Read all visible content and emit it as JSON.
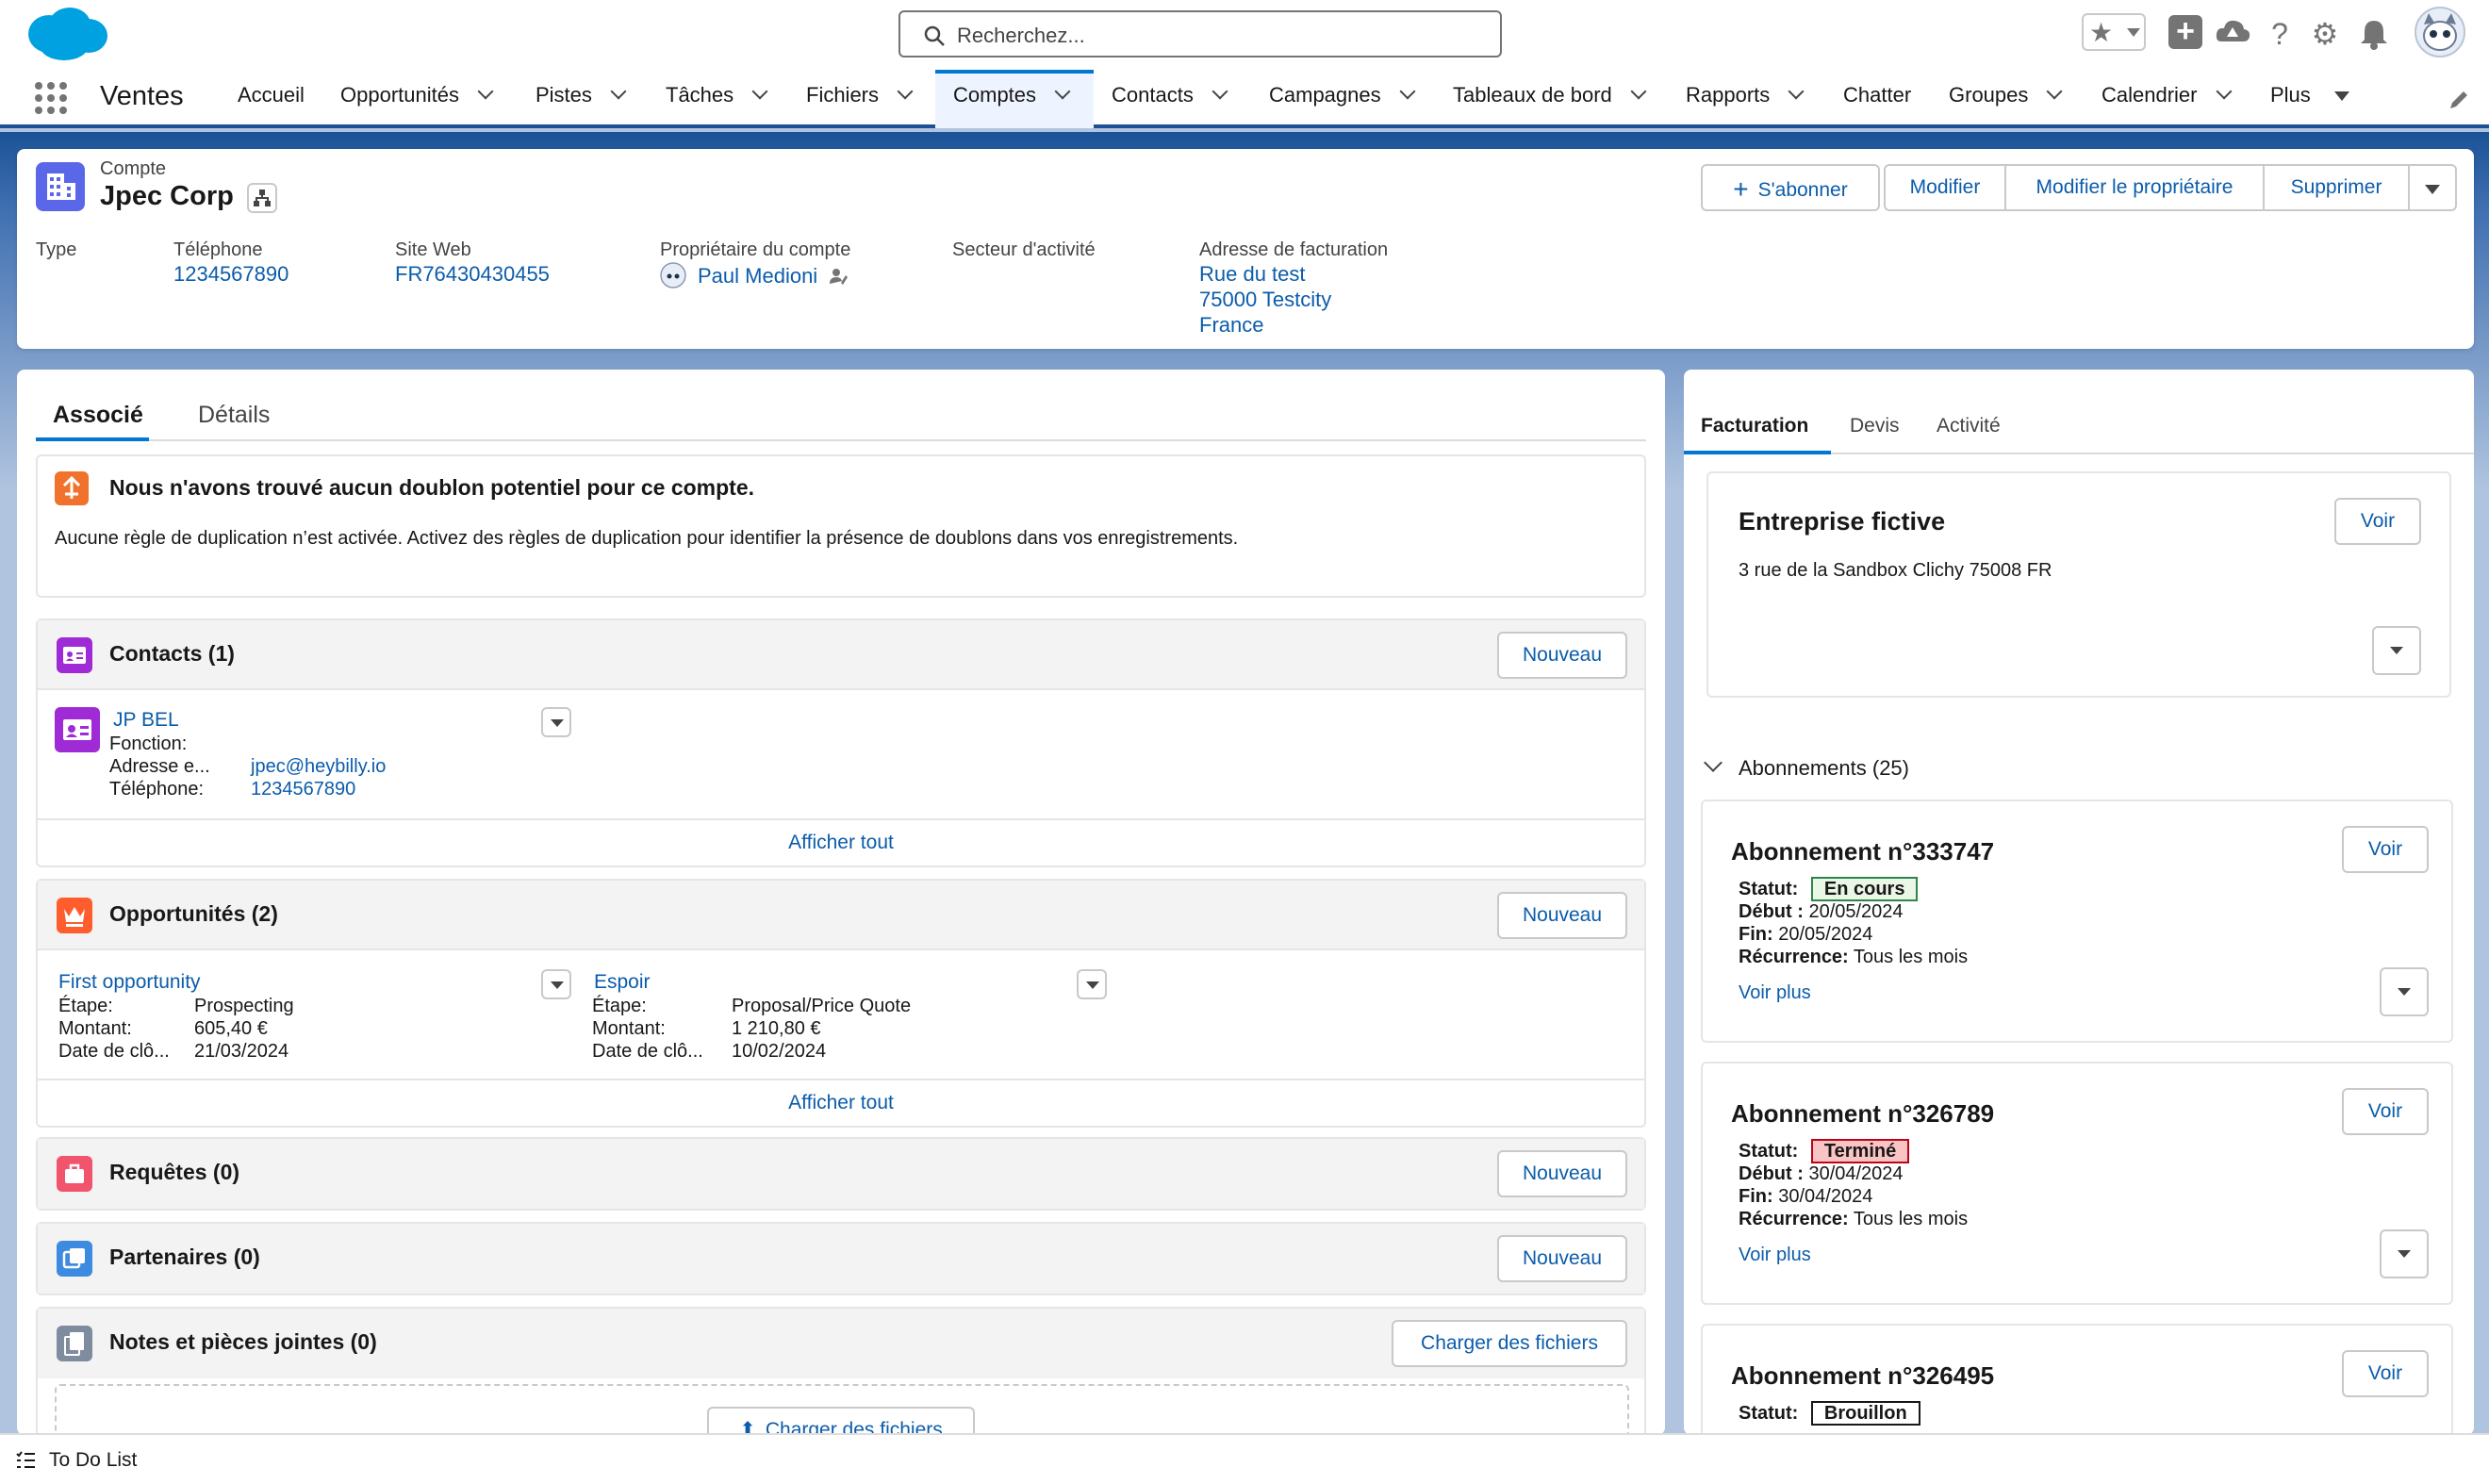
{
  "header": {
    "search_placeholder": "Recherchez...",
    "app_name": "Ventes"
  },
  "nav": {
    "items": [
      {
        "label": "Accueil",
        "dropdown": false
      },
      {
        "label": "Opportunités",
        "dropdown": true
      },
      {
        "label": "Pistes",
        "dropdown": true
      },
      {
        "label": "Tâches",
        "dropdown": true
      },
      {
        "label": "Fichiers",
        "dropdown": true
      },
      {
        "label": "Comptes",
        "dropdown": true,
        "active": true
      },
      {
        "label": "Contacts",
        "dropdown": true
      },
      {
        "label": "Campagnes",
        "dropdown": true
      },
      {
        "label": "Tableaux de bord",
        "dropdown": true
      },
      {
        "label": "Rapports",
        "dropdown": true
      },
      {
        "label": "Chatter",
        "dropdown": false
      },
      {
        "label": "Groupes",
        "dropdown": true
      },
      {
        "label": "Calendrier",
        "dropdown": true
      },
      {
        "label": "Plus",
        "dropdown": true
      }
    ]
  },
  "record": {
    "object_label": "Compte",
    "name": "Jpec Corp",
    "actions": {
      "subscribe": "S'abonner",
      "edit": "Modifier",
      "change_owner": "Modifier le propriétaire",
      "delete": "Supprimer"
    },
    "fields": {
      "type_label": "Type",
      "phone_label": "Téléphone",
      "phone": "1234567890",
      "website_label": "Site Web",
      "website": "FR76430430455",
      "owner_label": "Propriétaire du compte",
      "owner": "Paul Medioni",
      "industry_label": "Secteur d'activité",
      "billing_label": "Adresse de facturation",
      "billing_line1": "Rue du test",
      "billing_line2": "75000 Testcity",
      "billing_line3": "France"
    }
  },
  "tabs": {
    "related": "Associé",
    "details": "Détails"
  },
  "duplicates": {
    "title": "Nous n'avons trouvé aucun doublon potentiel pour ce compte.",
    "message": "Aucune règle de duplication n’est activée. Activez des règles de duplication pour identifier la présence de doublons dans vos enregistrements."
  },
  "contacts": {
    "title": "Contacts (1)",
    "new": "Nouveau",
    "view_all": "Afficher tout",
    "items": [
      {
        "name": "JP BEL",
        "title_label": "Fonction:",
        "email_label": "Adresse e...",
        "email": "jpec@heybilly.io",
        "phone_label": "Téléphone:",
        "phone": "1234567890"
      }
    ]
  },
  "opportunities": {
    "title": "Opportunités (2)",
    "new": "Nouveau",
    "view_all": "Afficher tout",
    "stage_label": "Étape:",
    "amount_label": "Montant:",
    "close_label": "Date de clô...",
    "items": [
      {
        "name": "First opportunity",
        "stage": "Prospecting",
        "amount": "605,40 €",
        "close": "21/03/2024"
      },
      {
        "name": "Espoir",
        "stage": "Proposal/Price Quote",
        "amount": "1 210,80 €",
        "close": "10/02/2024"
      }
    ]
  },
  "cases": {
    "title": "Requêtes (0)",
    "new": "Nouveau"
  },
  "partners": {
    "title": "Partenaires (0)",
    "new": "Nouveau"
  },
  "notes": {
    "title": "Notes et pièces jointes (0)",
    "upload": "Charger des fichiers",
    "upload_inner": "Charger des fichiers"
  },
  "right": {
    "tabs": {
      "billing": "Facturation",
      "quotes": "Devis",
      "activity": "Activité"
    },
    "company": {
      "name": "Entreprise fictive",
      "address": "3 rue de la Sandbox Clichy 75008 FR",
      "view": "Voir"
    },
    "subscriptions_header": "Abonnements (25)",
    "status_label": "Statut:",
    "start_label": "Début :",
    "end_label": "Fin:",
    "recurrence_label": "Récurrence:",
    "view": "Voir",
    "view_more": "Voir plus",
    "subscriptions": [
      {
        "title": "Abonnement n°333747",
        "status": "En cours",
        "start": "20/05/2024",
        "end": "20/05/2024",
        "recurrence": "Tous les mois",
        "status_color": "#2e844a",
        "status_bg": "#ebf7e6"
      },
      {
        "title": "Abonnement n°326789",
        "status": "Terminé",
        "start": "30/04/2024",
        "end": "30/04/2024",
        "recurrence": "Tous les mois",
        "status_color": "#ba0517",
        "status_bg": "#fbc4c4"
      },
      {
        "title": "Abonnement n°326495",
        "status": "Brouillon",
        "status_color": "#181818",
        "status_bg": "#ffffff"
      }
    ]
  },
  "footer": {
    "todo": "To Do List"
  },
  "colors": {
    "brand": "#0176d3",
    "link": "#0b5cab",
    "nav_underline": "#1b5297"
  }
}
